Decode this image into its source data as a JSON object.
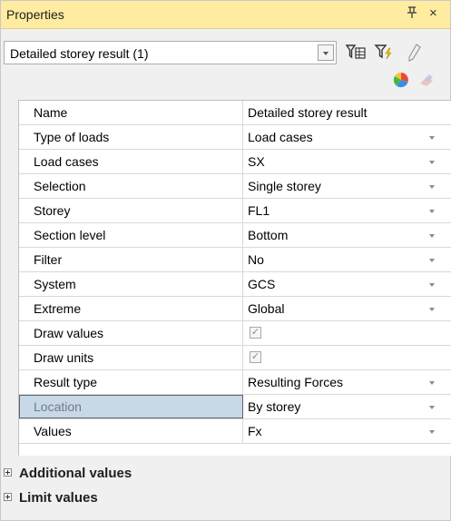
{
  "panel": {
    "title": "Properties",
    "pin_glyph": "ᵖ",
    "close_glyph": "×"
  },
  "selector": {
    "value": "Detailed storey result (1)"
  },
  "toolbar": {
    "icons": [
      "filter-table-icon",
      "filter-lightning-icon",
      "pencil-icon"
    ],
    "small_icons": [
      "color-wheel-icon",
      "eraser-icon"
    ]
  },
  "properties": [
    {
      "name": "Name",
      "value": "Detailed storey result",
      "type": "text"
    },
    {
      "name": "Type of loads",
      "value": "Load cases",
      "type": "dropdown"
    },
    {
      "name": "Load cases",
      "value": "SX",
      "type": "dropdown"
    },
    {
      "name": "Selection",
      "value": "Single storey",
      "type": "dropdown"
    },
    {
      "name": "Storey",
      "value": "FL1",
      "type": "dropdown"
    },
    {
      "name": "Section level",
      "value": "Bottom",
      "type": "dropdown"
    },
    {
      "name": "Filter",
      "value": "No",
      "type": "dropdown"
    },
    {
      "name": "System",
      "value": "GCS",
      "type": "dropdown"
    },
    {
      "name": "Extreme",
      "value": "Global",
      "type": "dropdown"
    },
    {
      "name": "Draw values",
      "value": "✓",
      "type": "checkbox"
    },
    {
      "name": "Draw units",
      "value": "✓",
      "type": "checkbox"
    },
    {
      "name": "Result type",
      "value": "Resulting Forces",
      "type": "dropdown"
    },
    {
      "name": "Location",
      "value": "By storey",
      "type": "dropdown",
      "selected": true
    },
    {
      "name": "Values",
      "value": "Fx",
      "type": "dropdown"
    }
  ],
  "sections": [
    {
      "label": "Additional values"
    },
    {
      "label": "Limit values"
    }
  ],
  "colors": {
    "title_bg": "#ffeca0",
    "selected_bg": "#c8d8e6"
  }
}
